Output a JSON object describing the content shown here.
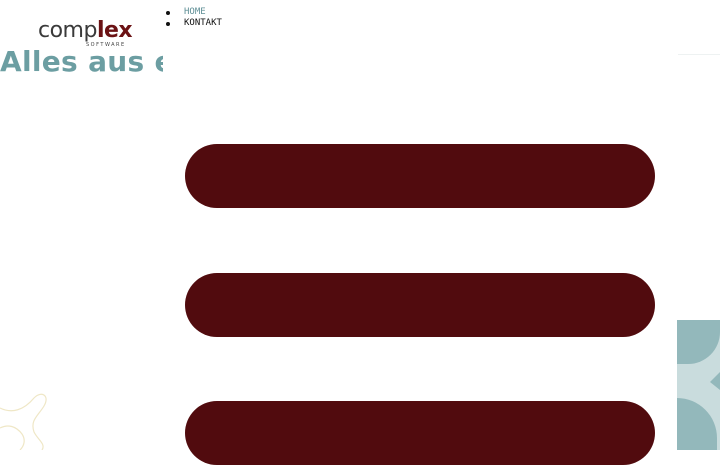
{
  "logo": {
    "word_part_1": "comp",
    "word_part_2": "lex",
    "tagline": "SOFTWARE"
  },
  "nav": {
    "items": [
      {
        "label": "HOME",
        "active": true
      },
      {
        "label": "KONTAKT",
        "active": false
      }
    ]
  },
  "hero": {
    "headline": "Alles aus ei"
  },
  "colors": {
    "accent": "#6c9ea2",
    "brand": "#510b0e",
    "nav_active": "#5f8f96",
    "deco_panel": "#c9dcdd",
    "deco_shape": "#93b8bb",
    "deco_outline": "#efe7c6"
  },
  "icons": {
    "menu": "hamburger-menu-icon"
  }
}
